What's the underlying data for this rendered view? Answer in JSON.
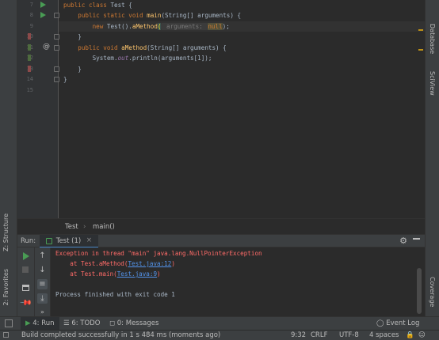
{
  "editor": {
    "line_numbers": [
      "7",
      "8",
      "9",
      "10",
      "11",
      "12",
      "13",
      "14",
      "15"
    ],
    "code": {
      "l7": {
        "kw1": "public class",
        "name": " Test {"
      },
      "l8": {
        "kw1": "    public static void ",
        "fn": "main",
        "rest": "(String[] arguments) {"
      },
      "l9": {
        "kw": "        new ",
        "pre": "Test().",
        "fn": "aMethod",
        "brk": "(",
        "hint": " arguments: ",
        "nul": "null",
        "post": ");"
      },
      "l10": {
        "text": "    }"
      },
      "l11": {
        "kw": "    public void ",
        "fn": "aMethod",
        "rest": "(String[] arguments) {"
      },
      "l12": {
        "pre": "        System.",
        "it": "out",
        "rest": ".println(arguments[1]);"
      },
      "l13": {
        "text": "    }"
      },
      "l14": {
        "text": "}"
      }
    },
    "at_marker": "@"
  },
  "breadcrumb": {
    "class": "Test",
    "sep": "›",
    "method": "main()"
  },
  "run_panel": {
    "label": "Run:",
    "tab": "Test (1)",
    "tab_close": "×",
    "console": {
      "line1": "Exception in thread \"main\" java.lang.NullPointerException",
      "line2_pre": "    at Test.aMethod(",
      "line2_link": "Test.java:12",
      "line2_post": ")",
      "line3_pre": "    at Test.main(",
      "line3_link": "Test.java:9",
      "line3_post": ")",
      "line4": "Process finished with exit code 1"
    }
  },
  "left_strip": {
    "structure": "Z: Structure",
    "favorites": "2: Favorites"
  },
  "right_strip": {
    "database": "Database",
    "sciview": "SciView",
    "coverage": "Coverage"
  },
  "bottom_tabs": {
    "run": "4: Run",
    "todo": "6: TODO",
    "messages": "0: Messages",
    "event_log": "Event Log"
  },
  "status": {
    "message": "Build completed successfully in 1 s 484 ms (moments ago)",
    "position": "9:32",
    "line_sep": "CRLF",
    "encoding": "UTF-8",
    "indent": "4 spaces"
  },
  "colors": {
    "keyword": "#cc7832",
    "function": "#ffc66d",
    "error": "#ff6b68",
    "link": "#5394ec",
    "run_green": "#499c54"
  }
}
